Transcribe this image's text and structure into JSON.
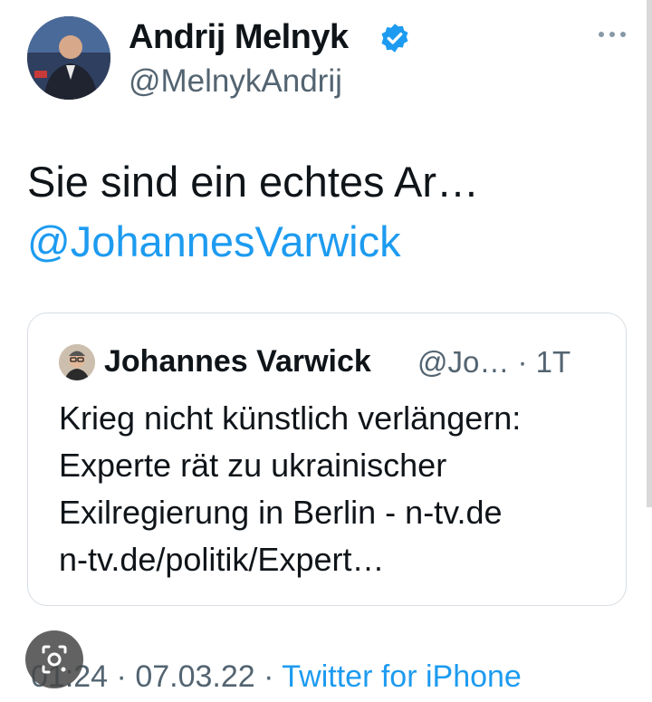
{
  "author": {
    "name": "Andrij Melnyk",
    "handle": "@MelnykAndrij",
    "verified": true
  },
  "tweet": {
    "text": "Sie sind ein echtes Ar…",
    "mention": "@JohannesVarwick"
  },
  "quote": {
    "author_name": "Johannes Varwick",
    "author_handle": "@Jo… · 1T",
    "lines": [
      "Krieg nicht künstlich verlängern:",
      "Experte rät zu ukrainischer",
      "Exilregierung in Berlin - n-tv.de",
      "n-tv.de/politik/Expert…"
    ]
  },
  "footer": {
    "time": "01:24",
    "separator1": " · ",
    "date": "07.03.22",
    "separator2": " · ",
    "source": "Twitter for iPhone"
  },
  "colors": {
    "link": "#1d9bf0",
    "muted": "#536471",
    "text": "#0f1419",
    "border": "#d6dde3"
  },
  "icons": {
    "verified": "verified-badge-icon",
    "more": "more-options-icon",
    "lens": "google-lens-icon"
  }
}
